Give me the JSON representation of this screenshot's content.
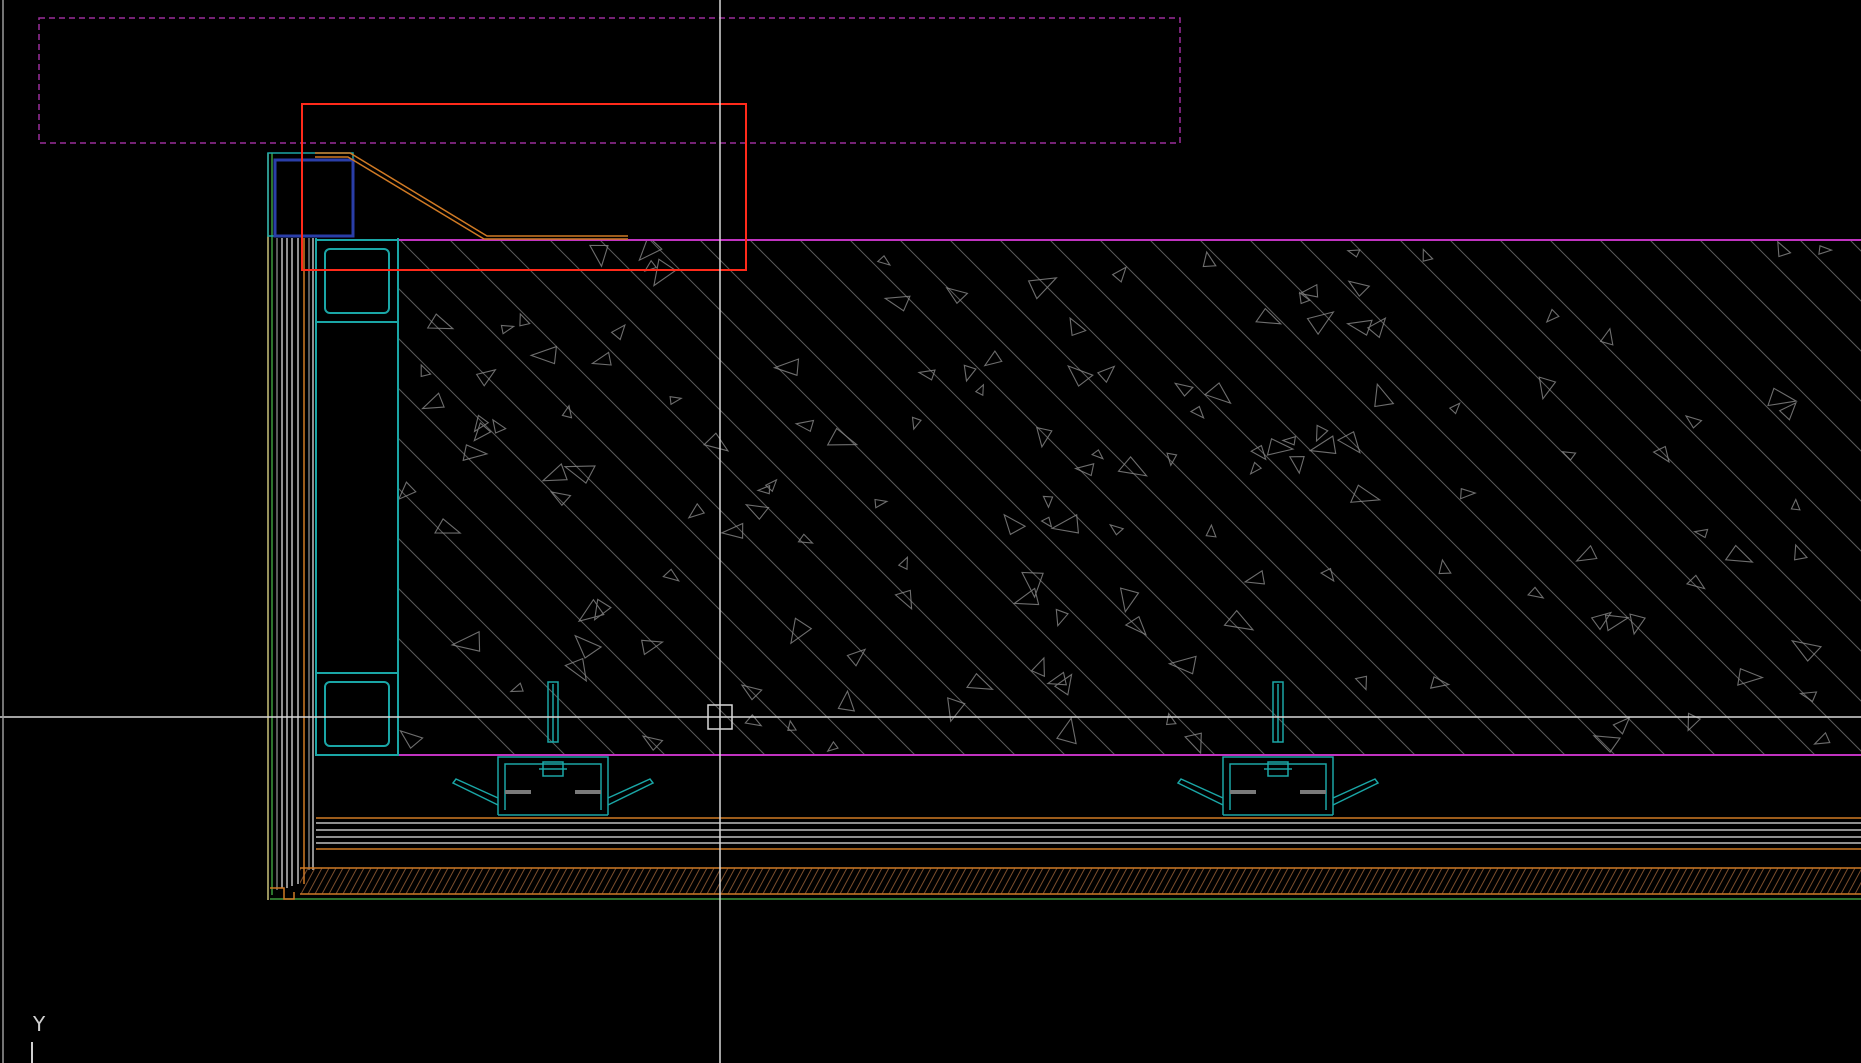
{
  "app": {
    "background_color": "#000000"
  },
  "ucs": {
    "axis_label": "Y"
  },
  "colors": {
    "magenta": "#c033c0",
    "dashed_magenta": "#9a2e9a",
    "cyan": "#1aa6a6",
    "cyan_bright": "#3fc9c9",
    "orange": "#d07a24",
    "orange_light": "#e0a050",
    "yellow": "#c9c27a",
    "green": "#3c9a3c",
    "blue": "#2a3ea8",
    "hatch": "#7a7a7a",
    "crosshair": "#d8d8d8",
    "highlight": "#ff2a1a"
  },
  "icons": {
    "cursor": "crosshair-pickbox-icon",
    "ucs": "ucs-y-axis-icon"
  }
}
